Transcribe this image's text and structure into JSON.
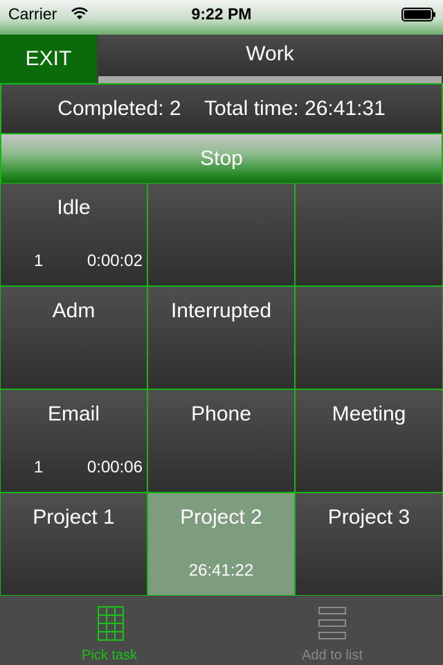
{
  "status_bar": {
    "carrier": "Carrier",
    "time": "9:22 PM"
  },
  "header": {
    "exit_label": "EXIT",
    "title": "Work"
  },
  "summary": {
    "completed": "Completed: 2",
    "total_time": "Total time: 26:41:31"
  },
  "stop_label": "Stop",
  "tasks": [
    {
      "name": "Idle",
      "count": "1",
      "time": "0:00:02"
    },
    {
      "name": "",
      "count": "",
      "time": ""
    },
    {
      "name": "",
      "count": "",
      "time": ""
    },
    {
      "name": "Adm",
      "count": "",
      "time": ""
    },
    {
      "name": "Interrupted",
      "count": "",
      "time": ""
    },
    {
      "name": "",
      "count": "",
      "time": ""
    },
    {
      "name": "Email",
      "count": "1",
      "time": "0:00:06"
    },
    {
      "name": "Phone",
      "count": "",
      "time": ""
    },
    {
      "name": "Meeting",
      "count": "",
      "time": ""
    },
    {
      "name": "Project 1",
      "count": "",
      "time": ""
    },
    {
      "name": "Project 2",
      "count": "",
      "time": "26:41:22",
      "active": true
    },
    {
      "name": "Project 3",
      "count": "",
      "time": ""
    }
  ],
  "tab_bar": {
    "pick_task": "Pick task",
    "add_to_list": "Add to list"
  },
  "colors": {
    "accent_green": "#17b617",
    "exit_green": "#0b6b0b",
    "active_tile": "#7e9c7e",
    "tab_active": "#18c318",
    "tab_inactive": "#8a8a8a"
  },
  "icons": {
    "wifi": "wifi-icon",
    "battery": "battery-icon",
    "pick_task": "grid-icon",
    "add_to_list": "list-icon"
  }
}
